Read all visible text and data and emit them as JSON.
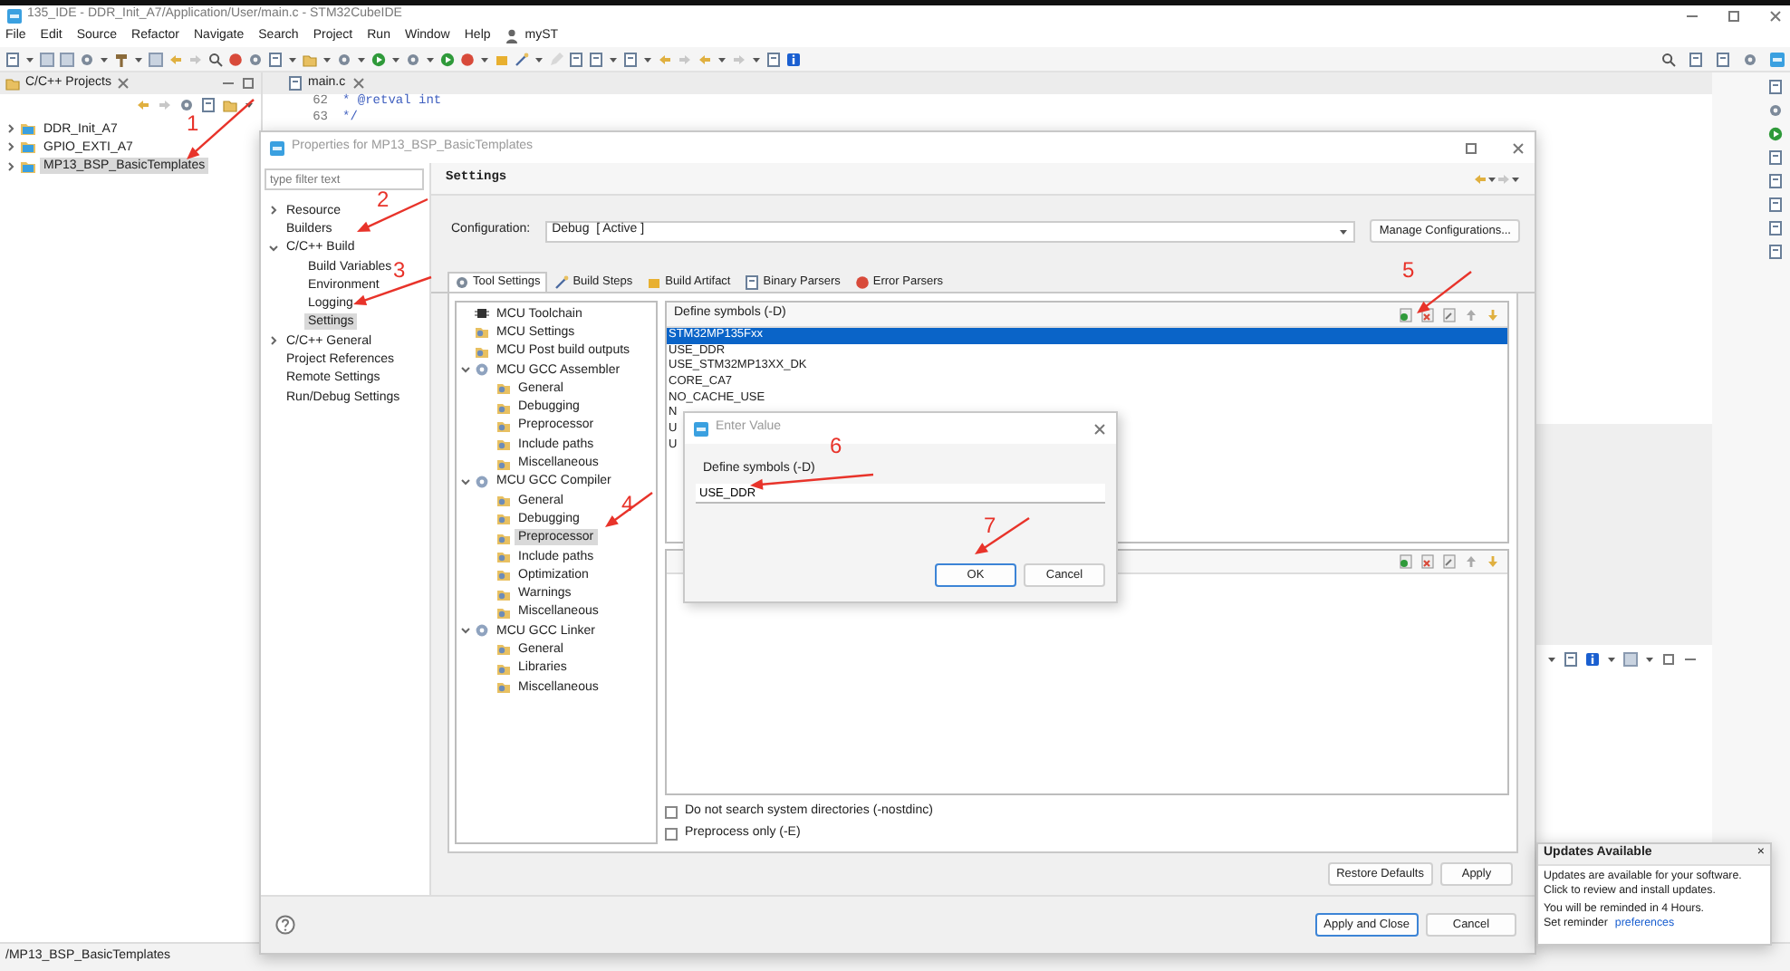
{
  "window": {
    "title": "135_IDE - DDR_Init_A7/Application/User/main.c - STM32CubeIDE"
  },
  "menu": [
    {
      "label": "File",
      "kind": "menu"
    },
    {
      "label": "Edit",
      "kind": "menu"
    },
    {
      "label": "Source",
      "kind": "menu"
    },
    {
      "label": "Refactor",
      "kind": "menu"
    },
    {
      "label": "Navigate",
      "kind": "menu"
    },
    {
      "label": "Search",
      "kind": "menu"
    },
    {
      "label": "Project",
      "kind": "menu"
    },
    {
      "label": "Run",
      "kind": "menu"
    },
    {
      "label": "Window",
      "kind": "menu"
    },
    {
      "label": "Help",
      "kind": "menu"
    },
    {
      "label": "myST",
      "kind": "account"
    }
  ],
  "projects_view": {
    "title": "C/C++ Projects",
    "items": [
      {
        "label": "DDR_Init_A7",
        "expanded": false,
        "selected": false
      },
      {
        "label": "GPIO_EXTI_A7",
        "expanded": false,
        "selected": false
      },
      {
        "label": "MP13_BSP_BasicTemplates",
        "expanded": false,
        "selected": true
      }
    ]
  },
  "editor": {
    "tab": "main.c",
    "lines": [
      {
        "number": "62",
        "code": "* @retval int"
      },
      {
        "number": "63",
        "code": "*/"
      }
    ]
  },
  "properties": {
    "title": "Properties for MP13_BSP_BasicTemplates",
    "filter": {
      "placeholder": "type filter text"
    },
    "nav": [
      {
        "label": "Resource",
        "expanded": false,
        "selected": false
      },
      {
        "label": "Builders",
        "selected": false
      },
      {
        "label": "C/C++ Build",
        "expanded": true,
        "selected": false,
        "children": [
          {
            "label": "Build Variables",
            "selected": false
          },
          {
            "label": "Environment",
            "selected": false
          },
          {
            "label": "Logging",
            "selected": false
          },
          {
            "label": "Settings",
            "selected": true
          }
        ]
      },
      {
        "label": "C/C++ General",
        "expanded": false,
        "selected": false
      },
      {
        "label": "Project References",
        "selected": false
      },
      {
        "label": "Remote Settings",
        "selected": false
      },
      {
        "label": "Run/Debug Settings",
        "selected": false
      }
    ],
    "page_title": "Settings",
    "configuration": {
      "label": "Configuration:",
      "value": "Debug  [ Active ]",
      "button": "Manage Configurations..."
    },
    "tabs": [
      {
        "label": "Tool Settings",
        "selected": true
      },
      {
        "label": "Build Steps",
        "selected": false
      },
      {
        "label": "Build Artifact",
        "selected": false
      },
      {
        "label": "Binary Parsers",
        "selected": false
      },
      {
        "label": "Error Parsers",
        "selected": false
      }
    ],
    "tool_tree": [
      {
        "label": "MCU Toolchain",
        "kind": "chip",
        "selected": false
      },
      {
        "label": "MCU Settings",
        "kind": "folder",
        "selected": false
      },
      {
        "label": "MCU Post build outputs",
        "kind": "folder",
        "selected": false
      },
      {
        "label": "MCU GCC Assembler",
        "kind": "tool",
        "expanded": true,
        "selected": false,
        "children": [
          {
            "label": "General",
            "kind": "folder",
            "selected": false
          },
          {
            "label": "Debugging",
            "kind": "folder",
            "selected": false
          },
          {
            "label": "Preprocessor",
            "kind": "folder",
            "selected": false
          },
          {
            "label": "Include paths",
            "kind": "folder",
            "selected": false
          },
          {
            "label": "Miscellaneous",
            "kind": "folder",
            "selected": false
          }
        ]
      },
      {
        "label": "MCU GCC Compiler",
        "kind": "tool",
        "expanded": true,
        "selected": false,
        "children": [
          {
            "label": "General",
            "kind": "folder",
            "selected": false
          },
          {
            "label": "Debugging",
            "kind": "folder",
            "selected": false
          },
          {
            "label": "Preprocessor",
            "kind": "folder",
            "selected": true
          },
          {
            "label": "Include paths",
            "kind": "folder",
            "selected": false
          },
          {
            "label": "Optimization",
            "kind": "folder",
            "selected": false
          },
          {
            "label": "Warnings",
            "kind": "folder",
            "selected": false
          },
          {
            "label": "Miscellaneous",
            "kind": "folder",
            "selected": false
          }
        ]
      },
      {
        "label": "MCU GCC Linker",
        "kind": "tool",
        "expanded": true,
        "selected": false,
        "children": [
          {
            "label": "General",
            "kind": "folder",
            "selected": false
          },
          {
            "label": "Libraries",
            "kind": "folder",
            "selected": false
          },
          {
            "label": "Miscellaneous",
            "kind": "folder",
            "selected": false
          }
        ]
      }
    ],
    "defines": {
      "title": "Define symbols (-D)",
      "items": [
        {
          "label": "STM32MP135Fxx",
          "selected": true
        },
        {
          "label": "USE_DDR",
          "selected": false
        },
        {
          "label": "USE_STM32MP13XX_DK",
          "selected": false
        },
        {
          "label": "CORE_CA7",
          "selected": false
        },
        {
          "label": "NO_CACHE_USE",
          "selected": false
        },
        {
          "label": "N",
          "selected": false
        },
        {
          "label": "U",
          "selected": false
        },
        {
          "label": "U",
          "selected": false
        }
      ]
    },
    "options": [
      {
        "label": "Do not search system directories (-nostdinc)",
        "checked": false
      },
      {
        "label": "Preprocess only (-E)",
        "checked": false
      }
    ],
    "page_buttons": [
      {
        "label": "Restore Defaults"
      },
      {
        "label": "Apply"
      }
    ],
    "buttons": [
      {
        "label": "Apply and Close",
        "default": true
      },
      {
        "label": "Cancel",
        "default": false
      }
    ]
  },
  "enter_value": {
    "title": "Enter Value",
    "label": "Define symbols (-D)",
    "value": "USE_DDR",
    "buttons": [
      {
        "label": "OK",
        "default": true
      },
      {
        "label": "Cancel",
        "default": false
      }
    ]
  },
  "notification": {
    "title": "Updates Available",
    "close": "×",
    "lines": [
      "Updates are available for your software.",
      "Click to review and install updates.",
      "You will be reminded in 4 Hours."
    ],
    "reminder": {
      "text": "Set reminder",
      "link": "preferences"
    }
  },
  "status_bar": {
    "text": "/MP13_BSP_BasicTemplates"
  },
  "annotations": [
    {
      "number": "1"
    },
    {
      "number": "2"
    },
    {
      "number": "3"
    },
    {
      "number": "4"
    },
    {
      "number": "5"
    },
    {
      "number": "6"
    },
    {
      "number": "7"
    }
  ]
}
